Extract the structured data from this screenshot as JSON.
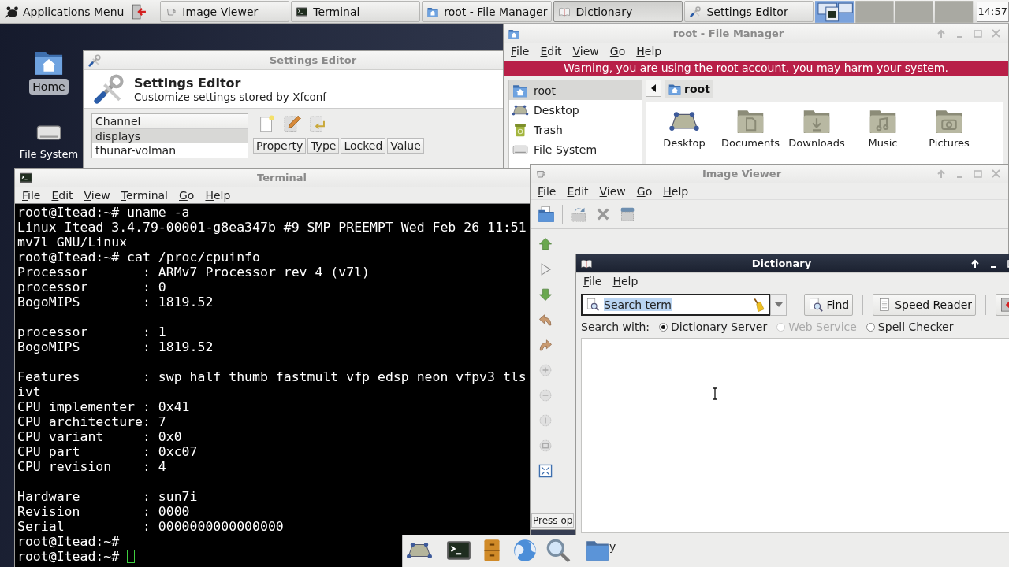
{
  "panel": {
    "menu_label": "Applications Menu",
    "tasks": [
      {
        "label": "Image Viewer",
        "selected": false
      },
      {
        "label": "Terminal",
        "selected": false
      },
      {
        "label": "root - File Manager",
        "selected": false
      },
      {
        "label": "Dictionary",
        "selected": true
      },
      {
        "label": "Settings Editor",
        "selected": false
      }
    ],
    "clock": "14:57"
  },
  "desktop_icons": [
    {
      "label": "Home",
      "kind": "home",
      "selected": true
    },
    {
      "label": "File System",
      "kind": "drive",
      "selected": false
    }
  ],
  "settings_editor": {
    "title": "Settings Editor",
    "heading": "Settings Editor",
    "subtitle": "Customize settings stored by Xfconf",
    "channel_header": "Channel",
    "channels": [
      {
        "label": "displays",
        "selected": true
      },
      {
        "label": "thunar-volman",
        "selected": false
      }
    ],
    "columns": [
      "Property",
      "Type",
      "Locked",
      "Value"
    ]
  },
  "file_manager": {
    "title": "root - File Manager",
    "menu": [
      "File",
      "Edit",
      "View",
      "Go",
      "Help"
    ],
    "warning": "Warning, you are using the root account, you may harm your system.",
    "places": [
      {
        "label": "root",
        "kind": "home",
        "selected": true
      },
      {
        "label": "Desktop",
        "kind": "desktop",
        "selected": false
      },
      {
        "label": "Trash",
        "kind": "trash",
        "selected": false
      },
      {
        "label": "File System",
        "kind": "drive",
        "selected": false
      }
    ],
    "path": "root",
    "items": [
      {
        "label": "Desktop",
        "kind": "desktop"
      },
      {
        "label": "Documents",
        "kind": "documents"
      },
      {
        "label": "Downloads",
        "kind": "downloads"
      },
      {
        "label": "Music",
        "kind": "music"
      },
      {
        "label": "Pictures",
        "kind": "pictures"
      }
    ]
  },
  "terminal": {
    "title": "Terminal",
    "menu": [
      "File",
      "Edit",
      "View",
      "Terminal",
      "Go",
      "Help"
    ],
    "blocks": [
      [
        "root@Itead:~# uname -a",
        "Linux Itead 3.4.79-00001-g8ea347b #9 SMP PREEMPT Wed Feb 26 11:51",
        "mv7l GNU/Linux",
        "root@Itead:~# cat /proc/cpuinfo",
        "Processor       : ARMv7 Processor rev 4 (v7l)",
        "processor       : 0",
        "BogoMIPS        : 1819.52"
      ],
      [
        "processor       : 1",
        "BogoMIPS        : 1819.52"
      ],
      [
        "Features        : swp half thumb fastmult vfp edsp neon vfpv3 tls",
        "ivt",
        "CPU implementer : 0x41",
        "CPU architecture: 7",
        "CPU variant     : 0x0",
        "CPU part        : 0xc07",
        "CPU revision    : 4"
      ],
      [
        "Hardware        : sun7i",
        "Revision        : 0000",
        "Serial          : 0000000000000000",
        "root@Itead:~#",
        "root@Itead:~#"
      ]
    ]
  },
  "image_viewer": {
    "title": "Image Viewer",
    "menu": [
      "File",
      "Edit",
      "View",
      "Go",
      "Help"
    ],
    "status": "Press op"
  },
  "dictionary": {
    "title": "Dictionary",
    "menu": [
      "File",
      "Help"
    ],
    "search": {
      "value": "Search term"
    },
    "buttons": [
      "Find",
      "Speed Reader"
    ],
    "search_with": "Search with:",
    "sources": [
      {
        "label": "Dictionary Server",
        "selected": true,
        "disabled": false
      },
      {
        "label": "Web Service",
        "selected": false,
        "disabled": true
      },
      {
        "label": "Spell Checker",
        "selected": false,
        "disabled": false
      }
    ],
    "status": "y"
  }
}
